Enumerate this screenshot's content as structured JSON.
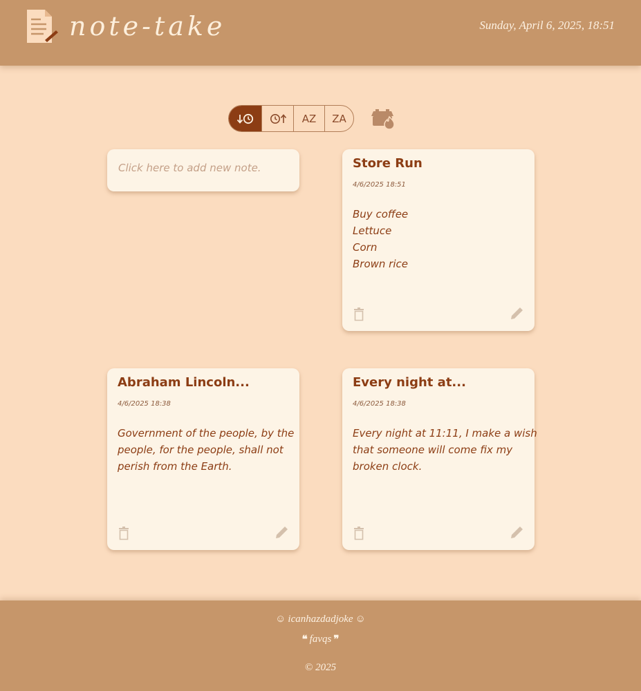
{
  "header": {
    "brand": "note-take",
    "datetime": "Sunday, April 6, 2025, 18:51",
    "logo_icon": "notepad-pencil-icon"
  },
  "toolbar": {
    "sort_buttons": [
      {
        "icon": "sort-newest-icon",
        "active": true
      },
      {
        "icon": "sort-oldest-icon",
        "active": false
      },
      {
        "label": "AZ",
        "active": false
      },
      {
        "label": "ZA",
        "active": false
      }
    ],
    "market_icon": "storefront-fire-icon"
  },
  "new_note": {
    "placeholder": "Click here to add new note."
  },
  "notes": [
    {
      "title": "Store Run",
      "date": "4/6/2025 18:51",
      "lines": [
        "Buy coffee",
        "Lettuce",
        "Corn",
        "Brown rice"
      ]
    },
    {
      "title": "Abraham Lincoln...",
      "date": "4/6/2025 18:38",
      "lines": [
        "Government of the people, by the",
        "people, for the people, shall not",
        "perish from the Earth."
      ]
    },
    {
      "title": "Every night at...",
      "date": "4/6/2025 18:38",
      "lines": [
        "Every night at 11:11, I make a wish",
        "that someone will come fix my",
        "broken clock."
      ]
    }
  ],
  "footer": {
    "joke_link": "icanhazdadjoke",
    "quotes_link": "favqs",
    "copyright": "© 2025"
  },
  "colors": {
    "header_bg": "#c6966a",
    "page_bg": "#fbdcbf",
    "card_bg": "#fdf4e6",
    "accent": "#8c3d14"
  }
}
